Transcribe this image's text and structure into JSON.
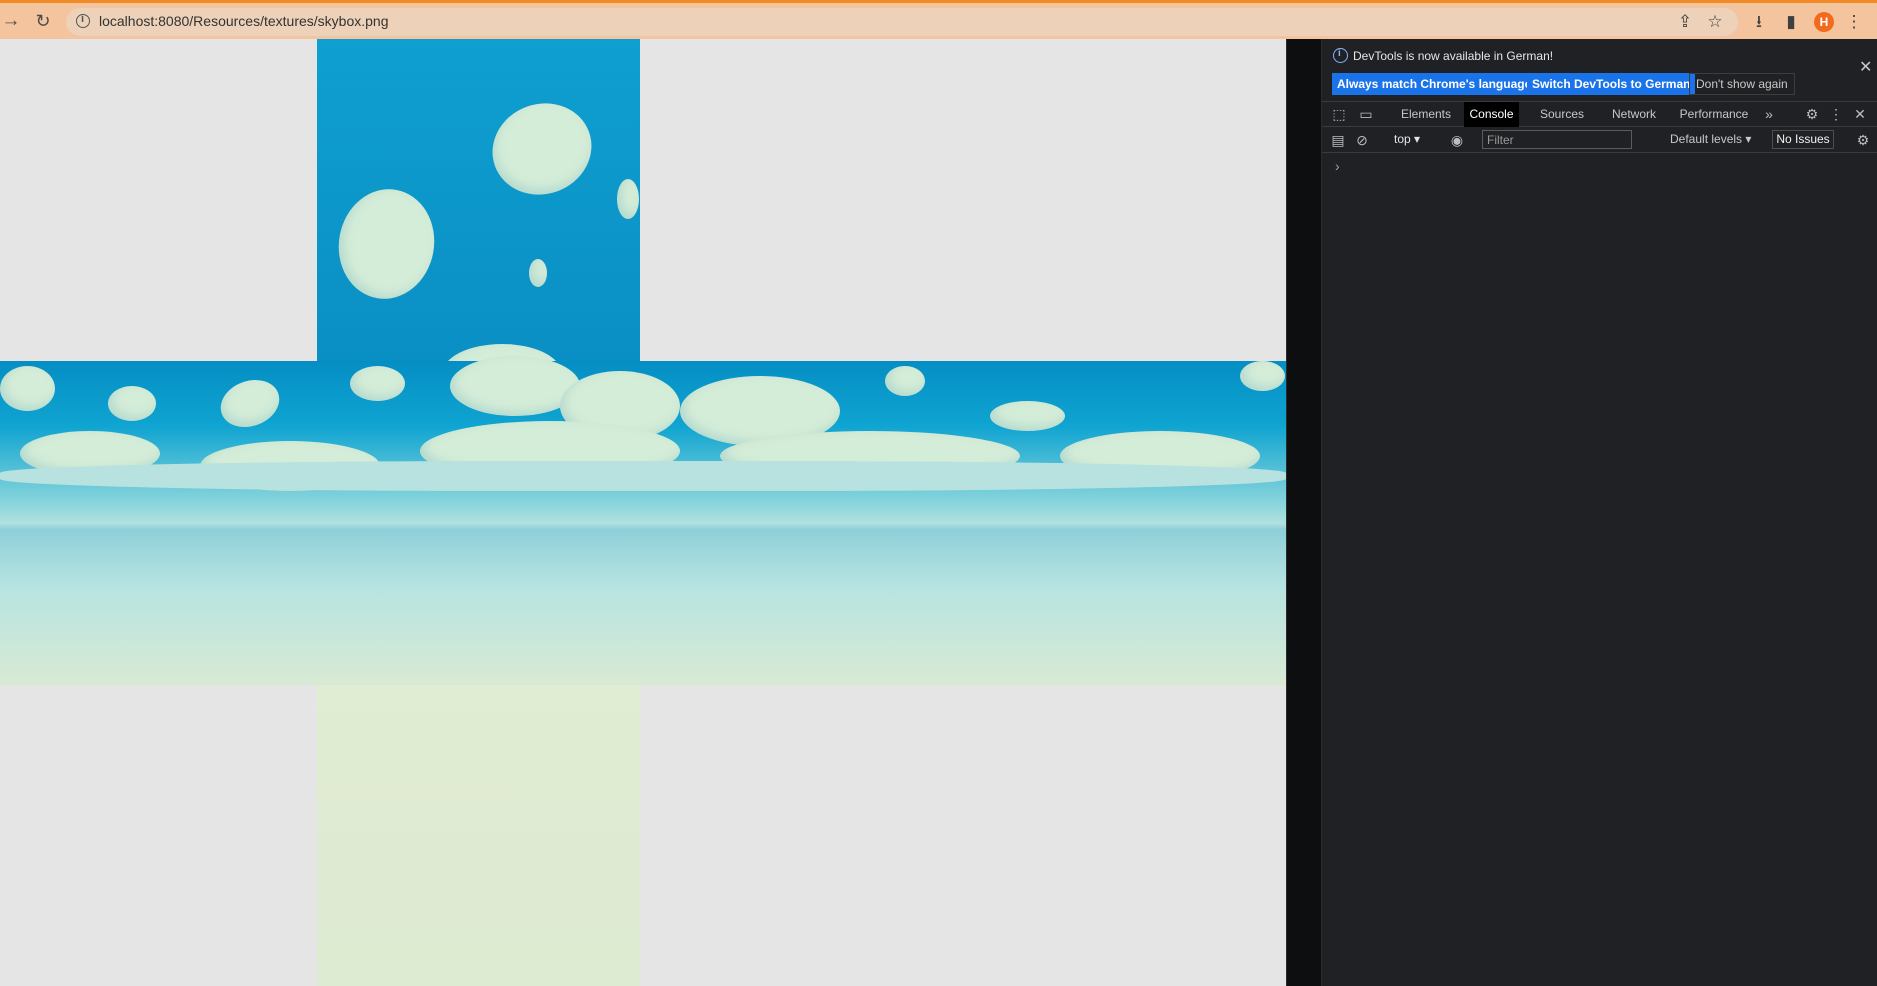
{
  "browser": {
    "url": "localhost:8080/Resources/textures/skybox.png",
    "avatar_letter": "H",
    "accent_color": "#f08a24"
  },
  "image": {
    "description_name": "skybox-cubemap",
    "colors": {
      "sky_blue": "#0a8fc4",
      "cloud": "#d4edd8",
      "horizon": "#b2e1e1",
      "background": "#e5e5e5"
    }
  },
  "devtools": {
    "banner": {
      "text": "DevTools is now available in German!",
      "btn_match": "Always match Chrome's language",
      "btn_switch": "Switch DevTools to German",
      "btn_dont_show": "Don't show again"
    },
    "tabs": [
      "Elements",
      "Console",
      "Sources",
      "Network",
      "Performance"
    ],
    "active_tab": "Console",
    "toolbar": {
      "context": "top",
      "filter_placeholder": "Filter",
      "levels": "Default levels",
      "issues": "No Issues"
    },
    "prompt_symbol": "›"
  }
}
